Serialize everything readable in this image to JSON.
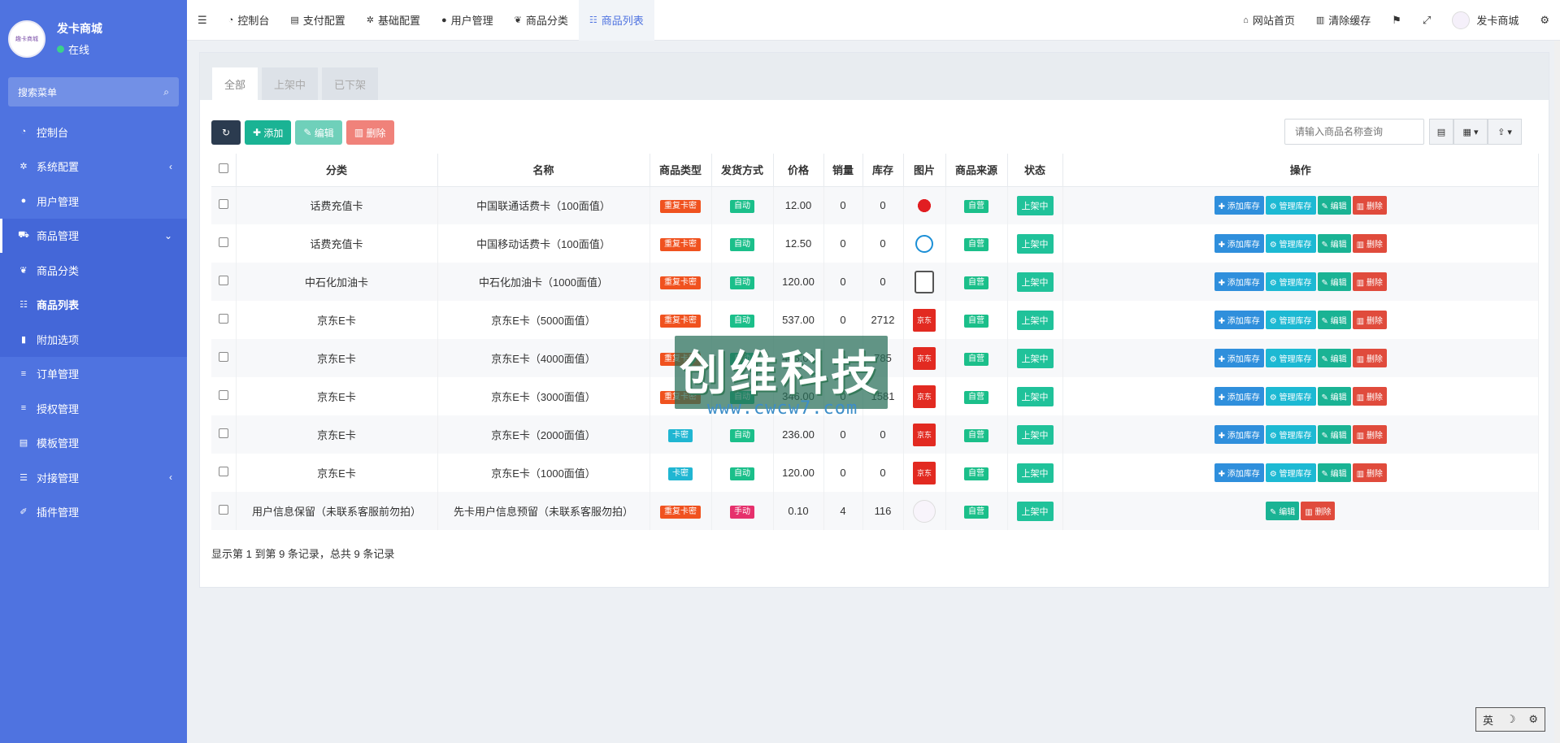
{
  "brand": {
    "name": "发卡商城",
    "status": "在线",
    "avatar_text": "趣卡商城"
  },
  "search_menu": {
    "placeholder": "搜索菜单"
  },
  "sidebar": {
    "items": [
      {
        "label": "控制台",
        "icon": "dashboard-icon"
      },
      {
        "label": "系统配置",
        "icon": "gear-icon",
        "arrow": "‹"
      },
      {
        "label": "用户管理",
        "icon": "user-icon"
      },
      {
        "label": "商品管理",
        "icon": "cart-icon",
        "arrow": "⌄"
      },
      {
        "label": "商品分类",
        "icon": "leaf-icon"
      },
      {
        "label": "商品列表",
        "icon": "list-icon"
      },
      {
        "label": "附加选项",
        "icon": "bookmark-icon"
      },
      {
        "label": "订单管理",
        "icon": "menu-icon"
      },
      {
        "label": "授权管理",
        "icon": "menu-icon"
      },
      {
        "label": "模板管理",
        "icon": "table-icon"
      },
      {
        "label": "对接管理",
        "icon": "sliders-icon",
        "arrow": "‹"
      },
      {
        "label": "插件管理",
        "icon": "plug-icon"
      }
    ]
  },
  "navbar": {
    "tabs": [
      "控制台",
      "支付配置",
      "基础配置",
      "用户管理",
      "商品分类",
      "商品列表"
    ],
    "right": {
      "home": "网站首页",
      "cache": "清除缓存",
      "user": "发卡商城"
    }
  },
  "tabs": [
    "全部",
    "上架中",
    "已下架"
  ],
  "toolbar": {
    "add": "添加",
    "edit": "编辑",
    "delete": "删除"
  },
  "search": {
    "placeholder": "请输入商品名称查询"
  },
  "table": {
    "headers": [
      "分类",
      "名称",
      "商品类型",
      "发货方式",
      "价格",
      "销量",
      "库存",
      "图片",
      "商品来源",
      "状态",
      "操作"
    ],
    "rows": [
      {
        "cat": "话费充值卡",
        "name": "中国联通话费卡（100面值）",
        "type": "重复卡密",
        "type_color": "red",
        "ship": "自动",
        "ship_color": "green",
        "price": "12.00",
        "sold": "0",
        "stock": "0",
        "pic": "unicom",
        "src": "自营",
        "status": "上架中"
      },
      {
        "cat": "话费充值卡",
        "name": "中国移动话费卡（100面值）",
        "type": "重复卡密",
        "type_color": "red",
        "ship": "自动",
        "ship_color": "green",
        "price": "12.50",
        "sold": "0",
        "stock": "0",
        "pic": "mobile",
        "src": "自营",
        "status": "上架中"
      },
      {
        "cat": "中石化加油卡",
        "name": "中石化加油卡（1000面值）",
        "type": "重复卡密",
        "type_color": "red",
        "ship": "自动",
        "ship_color": "green",
        "price": "120.00",
        "sold": "0",
        "stock": "0",
        "pic": "sinopec",
        "src": "自营",
        "status": "上架中"
      },
      {
        "cat": "京东E卡",
        "name": "京东E卡（5000面值）",
        "type": "重复卡密",
        "type_color": "red",
        "ship": "自动",
        "ship_color": "green",
        "price": "537.00",
        "sold": "0",
        "stock": "2712",
        "pic": "jd",
        "src": "自营",
        "status": "上架中"
      },
      {
        "cat": "京东E卡",
        "name": "京东E卡（4000面值）",
        "type": "重复卡密",
        "type_color": "red",
        "ship": "自动",
        "ship_color": "green",
        "price": "445.00",
        "sold": "0",
        "stock": "785",
        "pic": "jd",
        "src": "自营",
        "status": "上架中"
      },
      {
        "cat": "京东E卡",
        "name": "京东E卡（3000面值）",
        "type": "重复卡密",
        "type_color": "red",
        "ship": "自动",
        "ship_color": "green",
        "price": "346.00",
        "sold": "0",
        "stock": "1581",
        "pic": "jd",
        "src": "自营",
        "status": "上架中"
      },
      {
        "cat": "京东E卡",
        "name": "京东E卡（2000面值）",
        "type": "卡密",
        "type_color": "cyan",
        "ship": "自动",
        "ship_color": "green",
        "price": "236.00",
        "sold": "0",
        "stock": "0",
        "pic": "jd",
        "src": "自营",
        "status": "上架中"
      },
      {
        "cat": "京东E卡",
        "name": "京东E卡（1000面值）",
        "type": "卡密",
        "type_color": "cyan",
        "ship": "自动",
        "ship_color": "green",
        "price": "120.00",
        "sold": "0",
        "stock": "0",
        "pic": "jd",
        "src": "自营",
        "status": "上架中"
      },
      {
        "cat": "用户信息保留（未联系客服前勿拍）",
        "name": "先卡用户信息预留（未联系客服勿拍）",
        "type": "重复卡密",
        "type_color": "red",
        "ship": "手动",
        "ship_color": "pink",
        "price": "0.10",
        "sold": "4",
        "stock": "116",
        "pic": "fk",
        "src": "自营",
        "status": "上架中",
        "limited_ops": true
      }
    ],
    "ops": {
      "add_stock": "添加库存",
      "manage_stock": "管理库存",
      "edit": "编辑",
      "delete": "删除"
    },
    "jd_text": "京东"
  },
  "footer": {
    "summary": "显示第 1 到第 9 条记录，总共 9 条记录"
  },
  "watermark": {
    "text": "创维科技",
    "url": "www.cwcw7.com"
  },
  "ime": {
    "a": "英",
    "b": "☽",
    "c": "⚙"
  }
}
